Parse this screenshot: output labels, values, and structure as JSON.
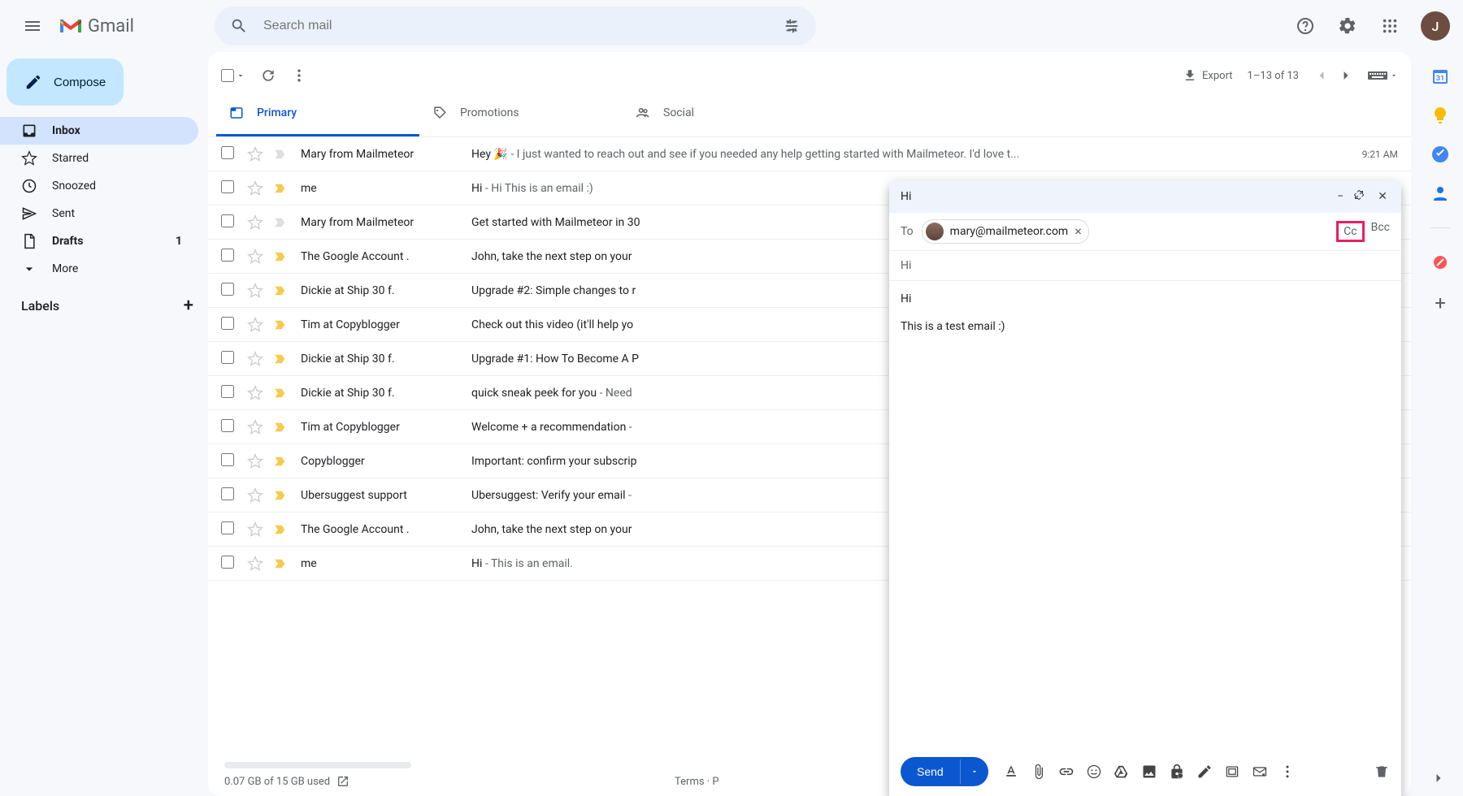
{
  "app": {
    "name": "Gmail"
  },
  "search": {
    "placeholder": "Search mail"
  },
  "avatar_initial": "J",
  "compose_label": "Compose",
  "nav": [
    {
      "icon": "inbox",
      "label": "Inbox",
      "active": true,
      "count": ""
    },
    {
      "icon": "star",
      "label": "Starred"
    },
    {
      "icon": "clock",
      "label": "Snoozed"
    },
    {
      "icon": "send",
      "label": "Sent"
    },
    {
      "icon": "draft",
      "label": "Drafts",
      "count": "1",
      "bold": true
    },
    {
      "icon": "more",
      "label": "More"
    }
  ],
  "labels_header": "Labels",
  "toolbar": {
    "export": "Export",
    "range": "1–13 of 13"
  },
  "tabs": [
    {
      "name": "Primary",
      "active": true
    },
    {
      "name": "Promotions"
    },
    {
      "name": "Social"
    }
  ],
  "rows": [
    {
      "imp": false,
      "sender": "Mary from Mailmeteor",
      "subject": "Hey 🎉",
      "snippet": " - I just wanted to reach out and see if you needed any help getting started with Mailmeteor. I'd love t...",
      "time": "9:21 AM"
    },
    {
      "imp": true,
      "sender": "me",
      "subject": "Hi",
      "snippet": " - Hi This is an email :)",
      "time": ""
    },
    {
      "imp": false,
      "sender": "Mary from Mailmeteor",
      "subject": "Get started with Mailmeteor in 30",
      "snippet": "",
      "time": ""
    },
    {
      "imp": true,
      "sender": "The Google Account .",
      "subject": "John, take the next step on your",
      "snippet": "",
      "time": ""
    },
    {
      "imp": true,
      "sender": "Dickie at Ship 30 f.",
      "subject": "Upgrade #2: Simple changes to r",
      "snippet": "",
      "time": ""
    },
    {
      "imp": true,
      "sender": "Tim at Copyblogger",
      "subject": "Check out this video (it'll help yo",
      "snippet": "",
      "time": ""
    },
    {
      "imp": true,
      "sender": "Dickie at Ship 30 f.",
      "subject": "Upgrade #1: How To Become A P",
      "snippet": "",
      "time": ""
    },
    {
      "imp": true,
      "sender": "Dickie at Ship 30 f.",
      "subject": "quick sneak peek for you",
      "snippet": " - Need",
      "time": ""
    },
    {
      "imp": true,
      "sender": "Tim at Copyblogger",
      "subject": "Welcome + a recommendation",
      "snippet": " - ",
      "time": ""
    },
    {
      "imp": true,
      "sender": "Copyblogger",
      "subject": "Important: confirm your subscrip",
      "snippet": "",
      "time": ""
    },
    {
      "imp": true,
      "sender": "Ubersuggest support",
      "subject": "Ubersuggest: Verify your email",
      "snippet": " - ",
      "time": ""
    },
    {
      "imp": true,
      "sender": "The Google Account .",
      "subject": "John, take the next step on your",
      "snippet": "",
      "time": ""
    },
    {
      "imp": true,
      "sender": "me",
      "subject": "Hi",
      "snippet": " - This is an email.",
      "time": ""
    }
  ],
  "storage": "0.07 GB of 15 GB used",
  "footer_links": "Terms · P",
  "compose_window": {
    "title": "Hi",
    "to_label": "To",
    "recipient": "mary@mailmeteor.com",
    "cc": "Cc",
    "bcc": "Bcc",
    "subject": "Hi",
    "body_line1": "Hi",
    "body_line2": "This is a test email :)",
    "send": "Send"
  }
}
